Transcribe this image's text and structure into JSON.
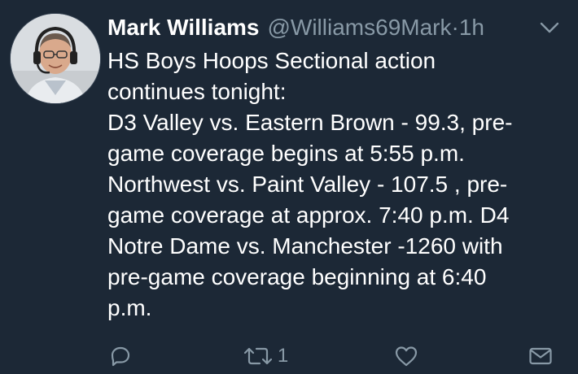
{
  "tweet": {
    "display_name": "Mark Williams",
    "handle": "@Williams69Mark",
    "separator": "·",
    "time": "1h",
    "text": "HS Boys Hoops Sectional action\ncontinues tonight:\nD3 Valley vs. Eastern Brown - 99.3, pre-\ngame coverage begins at 5:55 p.m.\nNorthwest vs. Paint Valley - 107.5 , pre-\ngame coverage at approx. 7:40 p.m. D4\nNotre Dame vs. Manchester -1260 with\npre-game coverage beginning at 6:40\np.m."
  },
  "actions": {
    "reply": {
      "icon": "reply-icon",
      "count": ""
    },
    "retweet": {
      "icon": "retweet-icon",
      "count": "1"
    },
    "like": {
      "icon": "heart-icon",
      "count": ""
    },
    "message": {
      "icon": "mail-icon",
      "count": ""
    }
  },
  "colors": {
    "background": "#1c2836",
    "primary_text": "#ffffff",
    "secondary_text": "#8899a6"
  }
}
